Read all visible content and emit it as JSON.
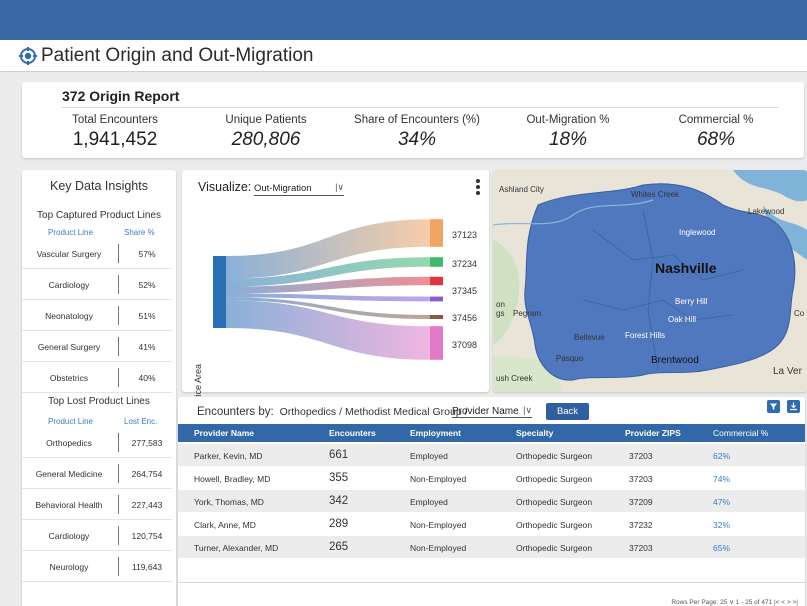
{
  "page": {
    "title": "Patient Origin and Out-Migration"
  },
  "report": {
    "title": "372 Origin Report",
    "kpis": [
      {
        "label": "Total Encounters",
        "value": "1,941,452"
      },
      {
        "label": "Unique Patients",
        "value": "280,806"
      },
      {
        "label": "Share of Encounters (%)",
        "value": "34%"
      },
      {
        "label": "Out-Migration %",
        "value": "18%"
      },
      {
        "label": "Commercial %",
        "value": "68%"
      }
    ]
  },
  "insights": {
    "title": "Key Data Insights",
    "captured": {
      "title": "Top Captured Product Lines",
      "col1": "Product Line",
      "col2": "Share %",
      "rows": [
        {
          "name": "Vascular Surgery",
          "value": "57%"
        },
        {
          "name": "Cardiology",
          "value": "52%"
        },
        {
          "name": "Neonatology",
          "value": "51%"
        },
        {
          "name": "General Surgery",
          "value": "41%"
        },
        {
          "name": "Obstetrics",
          "value": "40%"
        }
      ]
    },
    "lost": {
      "title": "Top Lost Product Lines",
      "col1": "Product Line",
      "col2": "Lost Enc.",
      "rows": [
        {
          "name": "Orthopedics",
          "value": "277,583"
        },
        {
          "name": "General Medicine",
          "value": "264,754"
        },
        {
          "name": "Behavioral Health",
          "value": "227,443"
        },
        {
          "name": "Cardiology",
          "value": "120,754"
        },
        {
          "name": "Neurology",
          "value": "119,643"
        }
      ]
    }
  },
  "sankey": {
    "visualize_label": "Visualize:",
    "visualize_value": "Out-Migration",
    "source_label": "Service Area",
    "targets": [
      {
        "zip": "37123",
        "share": 0.23,
        "color": "#f0a562"
      },
      {
        "zip": "37234",
        "share": 0.08,
        "color": "#3fb96d"
      },
      {
        "zip": "37345",
        "share": 0.07,
        "color": "#e0353f"
      },
      {
        "zip": "37456",
        "share": 0.04,
        "color": "#8a5ad6"
      },
      {
        "zip": "37456b",
        "share": 0.03,
        "color": "#8b5a3a"
      },
      {
        "zip": "37098",
        "share": 0.28,
        "color": "#e27ac8"
      }
    ],
    "target_labels": [
      "37123",
      "37234",
      "37345",
      "37456",
      "37098"
    ],
    "source_color": "#2a6fb6"
  },
  "map": {
    "labels": [
      {
        "text": "Ashland City"
      },
      {
        "text": "Whites Creek"
      },
      {
        "text": "Lakewood"
      },
      {
        "text": "Inglewood"
      },
      {
        "text": "Nashville"
      },
      {
        "text": "Berry Hill"
      },
      {
        "text": "Oak Hill"
      },
      {
        "text": "Forest Hills"
      },
      {
        "text": "Bellevue"
      },
      {
        "text": "Pasquo"
      },
      {
        "text": "Brentwood"
      },
      {
        "text": "Pegram"
      },
      {
        "text": "La Ver"
      },
      {
        "text": "ush Creek"
      },
      {
        "text": "on"
      },
      {
        "text": "gs"
      },
      {
        "text": "Co"
      }
    ]
  },
  "table": {
    "encounters_by": "Encounters by:",
    "crumb1": "Orthopedics",
    "crumb2": "Methodist Medical Group",
    "sep": "/",
    "select": "Provider Name",
    "back": "Back",
    "columns": [
      "Provider Name",
      "Encounters",
      "Employment",
      "Specialty",
      "Provider ZIPS",
      "Commercial %"
    ],
    "rows": [
      [
        "Parker, Kevin, MD",
        "661",
        "Employed",
        "Orthopedic Surgeon",
        "37203",
        "62%"
      ],
      [
        "Howell, Bradley, MD",
        "355",
        "Non-Employed",
        "Orthopedic Surgeon",
        "37203",
        "74%"
      ],
      [
        "York, Thomas, MD",
        "342",
        "Employed",
        "Orthopedic Surgeon",
        "37209",
        "47%"
      ],
      [
        "Clark, Anne, MD",
        "289",
        "Non-Employed",
        "Orthopedic Surgeon",
        "37232",
        "32%"
      ],
      [
        "Turner, Alexander, MD",
        "265",
        "Non-Employed",
        "Orthopedic Surgeon",
        "37203",
        "65%"
      ]
    ],
    "pager": "Rows Per Page: 25 ∨   1 - 25 of 471   |<  <  >  >|"
  }
}
